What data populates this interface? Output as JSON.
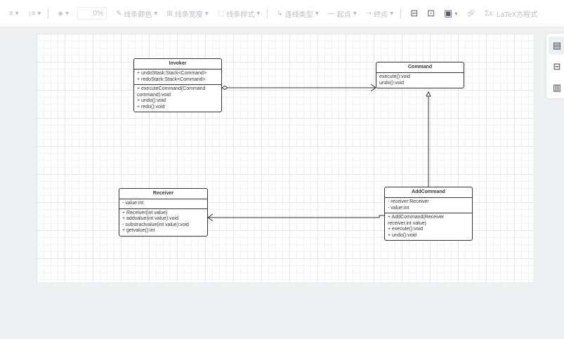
{
  "toolbar": {
    "align_icon": "align-icon",
    "line_height_icon": "line-spacing-icon",
    "fill_icon": "fill-bucket-icon",
    "opacity": "0%",
    "line_color": "线条颜色",
    "line_width": "线条宽度",
    "line_style": "线条样式",
    "connector_type": "连线类型",
    "start_point": "起点",
    "end_point": "终点",
    "latex": "LaTeX方程式"
  },
  "diagram": {
    "invoker": {
      "name": "Invoker",
      "attributes": [
        "+ undoStask:Stack<Command>",
        "+ redoStack:Stack<Command>"
      ],
      "methods": [
        "+ executeCommand(Command command):void",
        "+ undo():void",
        "+ redo():void"
      ]
    },
    "command": {
      "name": "Command",
      "methods": [
        "execute():void",
        "undo():void"
      ]
    },
    "receiver": {
      "name": "Receiver",
      "attributes": [
        "- value:int"
      ],
      "methods": [
        "+ Receiver(int value)",
        "+ addvalue(int value):void",
        "- substractvalue(int value):void",
        "+ getvalue():int"
      ]
    },
    "addcommand": {
      "name": "AddCommand",
      "attributes": [
        "- receiver:Receiver",
        "- value:int"
      ],
      "methods": [
        "+ AddCommand(Receiver receiver,int value)",
        "+ execute():void",
        "+ undo():void"
      ]
    }
  }
}
